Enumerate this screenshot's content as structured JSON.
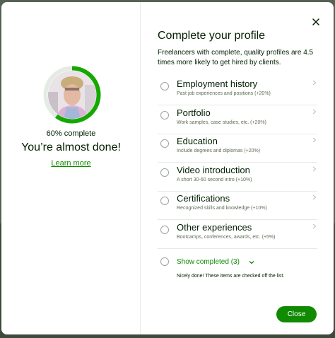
{
  "left": {
    "progress_percent": 60,
    "progress_label": "60% complete",
    "headline": "You’re almost done!",
    "learn_more": "Learn more"
  },
  "right": {
    "title": "Complete your profile",
    "intro": "Freelancers with complete, quality profiles are 4.5 times more likely to get hired by clients.",
    "items": [
      {
        "title": "Employment history",
        "subtitle": "Past job experiences and positions (+20%)"
      },
      {
        "title": "Portfolio",
        "subtitle": "Work samples, case studies, etc. (+20%)"
      },
      {
        "title": "Education",
        "subtitle": "Include degrees and diplomas (+20%)"
      },
      {
        "title": "Video introduction",
        "subtitle": "A short 30-60 second intro (+10%)"
      },
      {
        "title": "Certifications",
        "subtitle": "Recognized skills and knowledge (+10%)"
      },
      {
        "title": "Other experiences",
        "subtitle": "Bootcamps, conferences, awards, etc. (+5%)"
      }
    ],
    "show_completed": "Show completed (3)",
    "completed_note": "Nicely done! These items are checked off the list."
  },
  "buttons": {
    "close_label": "Close"
  },
  "colors": {
    "accent": "#108a00",
    "ring_track": "#e4ebe4",
    "text": "#001e00"
  },
  "icons": {
    "close": "close-icon",
    "chevron": "chevron-right-icon",
    "expand": "chevron-down-icon"
  }
}
